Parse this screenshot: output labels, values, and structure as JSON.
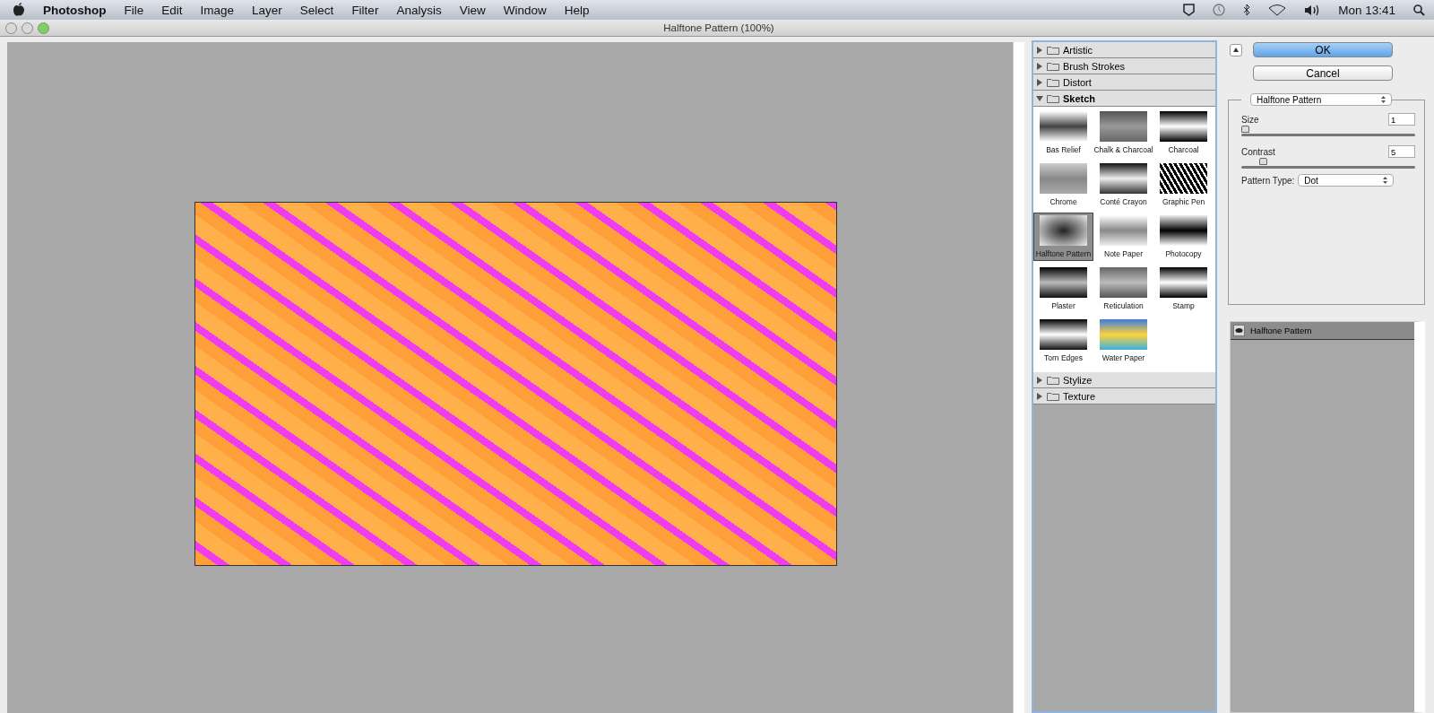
{
  "menu_bar": {
    "app": "Photoshop",
    "menus": [
      "File",
      "Edit",
      "Image",
      "Layer",
      "Select",
      "Filter",
      "Analysis",
      "View",
      "Window",
      "Help"
    ],
    "clock": "Mon 13:41"
  },
  "window": {
    "title": "Halftone Pattern (100%)"
  },
  "categories": [
    {
      "name": "Artistic",
      "expanded": false
    },
    {
      "name": "Brush Strokes",
      "expanded": false
    },
    {
      "name": "Distort",
      "expanded": false
    },
    {
      "name": "Sketch",
      "expanded": true,
      "filters": [
        {
          "name": "Bas Relief",
          "selected": false
        },
        {
          "name": "Chalk & Charcoal",
          "selected": false
        },
        {
          "name": "Charcoal",
          "selected": false
        },
        {
          "name": "Chrome",
          "selected": false
        },
        {
          "name": "Conté Crayon",
          "selected": false
        },
        {
          "name": "Graphic Pen",
          "selected": false
        },
        {
          "name": "Halftone Pattern",
          "selected": true
        },
        {
          "name": "Note Paper",
          "selected": false
        },
        {
          "name": "Photocopy",
          "selected": false
        },
        {
          "name": "Plaster",
          "selected": false
        },
        {
          "name": "Reticulation",
          "selected": false
        },
        {
          "name": "Stamp",
          "selected": false
        },
        {
          "name": "Torn Edges",
          "selected": false
        },
        {
          "name": "Water Paper",
          "selected": false
        }
      ]
    },
    {
      "name": "Stylize",
      "expanded": false
    },
    {
      "name": "Texture",
      "expanded": false
    }
  ],
  "buttons": {
    "ok": "OK",
    "cancel": "Cancel"
  },
  "settings": {
    "filter": "Halftone Pattern",
    "controls": [
      {
        "kind": "slider",
        "label": "Size",
        "value": "1",
        "level": 0.0
      },
      {
        "kind": "slider",
        "label": "Contrast",
        "value": "5",
        "level": 0.11
      },
      {
        "kind": "select",
        "label": "Pattern Type:",
        "value": "Dot"
      }
    ]
  },
  "layers": [
    {
      "name": "Halftone Pattern",
      "visible": true
    }
  ]
}
